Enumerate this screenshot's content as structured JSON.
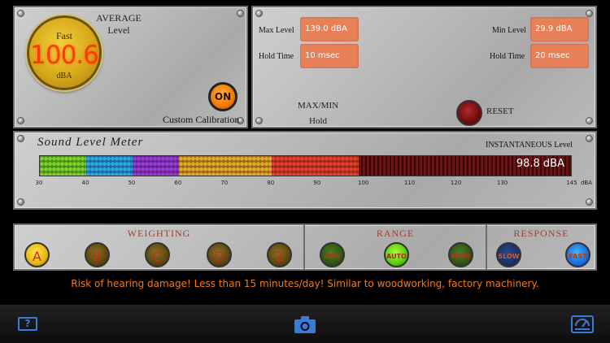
{
  "average": {
    "mode": "Fast",
    "value": "100.6",
    "unit": "dBA",
    "label_line1": "AVERAGE",
    "label_line2": "Level",
    "calibration_button": "ON",
    "calibration_label": "Custom Calibration"
  },
  "maxmin": {
    "max_label": "Max Level",
    "max_value": "139.0 dBA",
    "max_hold_label": "Hold Time",
    "max_hold_value": "10 msec",
    "min_label": "Min Level",
    "min_value": "29.9 dBA",
    "min_hold_label": "Hold Time",
    "min_hold_value": "20 msec",
    "hold_line1": "MAX/MIN",
    "hold_line2": "Hold",
    "reset_label": "RESET"
  },
  "meter": {
    "title": "Sound Level Meter",
    "inst_label": "INSTANTANEOUS  Level",
    "reading": "98.8 dBA",
    "level": 98.8,
    "scale_min": 30,
    "scale_max": 145,
    "ticks": [
      "30",
      "40",
      "50",
      "60",
      "70",
      "80",
      "90",
      "100",
      "110",
      "120",
      "130",
      "145",
      "dBA"
    ],
    "segment_colors": [
      "#7ad42a",
      "#2aa8e8",
      "#9a3ad8",
      "#e8a82a",
      "#e8402a"
    ]
  },
  "weighting": {
    "title": "WEIGHTING",
    "options": [
      "A",
      "B",
      "C",
      "D",
      "Z"
    ],
    "selected": "A"
  },
  "range": {
    "title": "RANGE",
    "options": [
      "LOW",
      "AUTO",
      "HIGH"
    ],
    "selected": "AUTO"
  },
  "response": {
    "title": "RESPONSE",
    "options": [
      "SLOW",
      "FAST"
    ],
    "selected": "FAST"
  },
  "warning": "Risk of hearing damage! Less than 15 minutes/day! Similar to woodworking, factory machinery.",
  "toolbar": {
    "help_glyph": "?",
    "help_icon": "help-icon",
    "camera_icon": "camera-icon",
    "meter_icon": "meter-icon",
    "accent": "#3a7ad8"
  }
}
